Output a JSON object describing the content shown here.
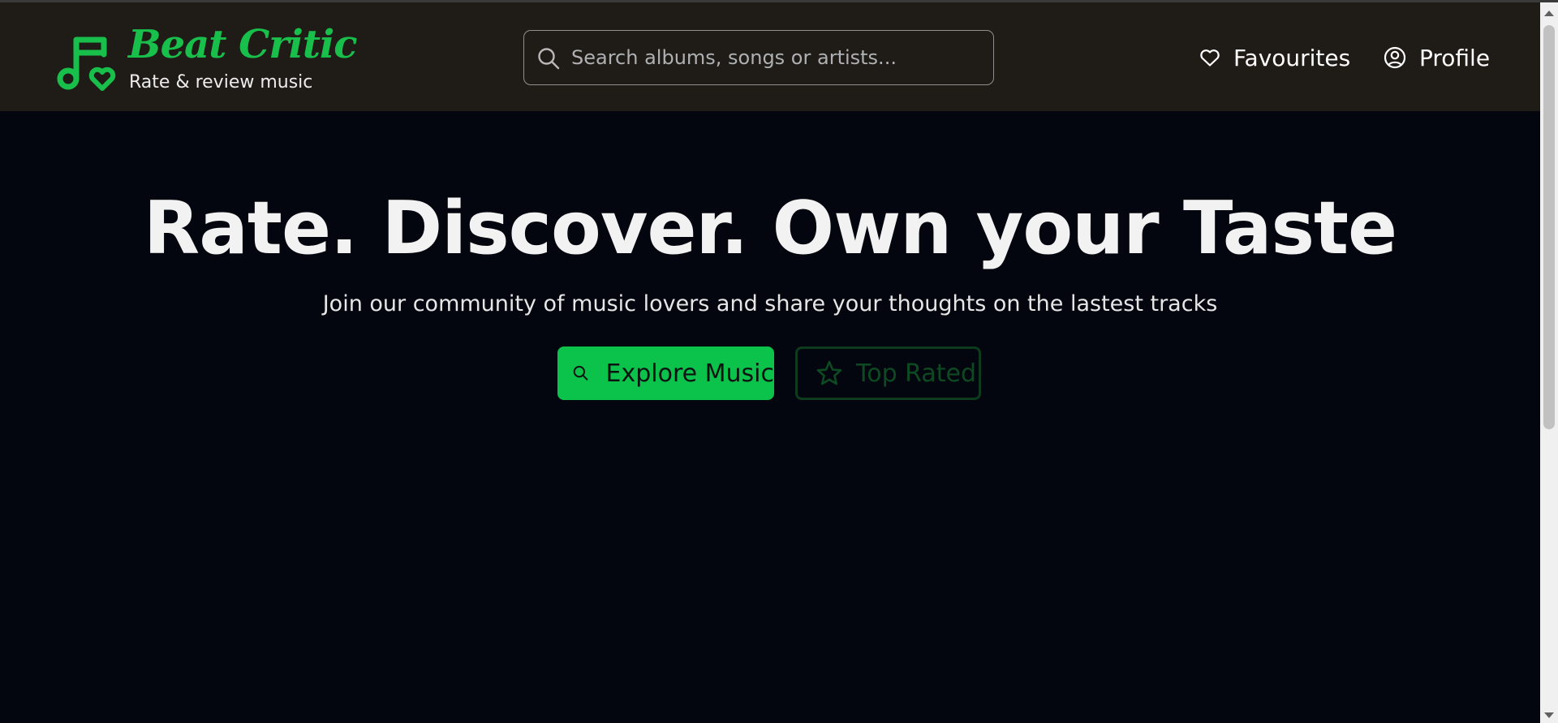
{
  "header": {
    "brand_name": "Beat Critic",
    "tagline": "Rate & review music",
    "search_placeholder": "Search albums, songs or artists...",
    "search_value": "",
    "nav": {
      "favourites_label": "Favourites",
      "profile_label": "Profile"
    }
  },
  "hero": {
    "title": "Rate. Discover. Own your Taste",
    "subtitle": "Join our community of music lovers and share your thoughts on the lastest tracks",
    "explore_label": "Explore Music",
    "top_rated_label": "Top Rated"
  },
  "icons": {
    "logo": "music-note-heart-icon",
    "search": "search-icon",
    "favourites": "heart-icon",
    "profile": "user-circle-icon",
    "explore": "search-icon",
    "top_rated": "star-icon"
  },
  "colors": {
    "accent": "#0bc24b",
    "header_bg": "#1f1c17",
    "page_bg": "#03060f",
    "top_rated_text": "#0d4a22"
  }
}
